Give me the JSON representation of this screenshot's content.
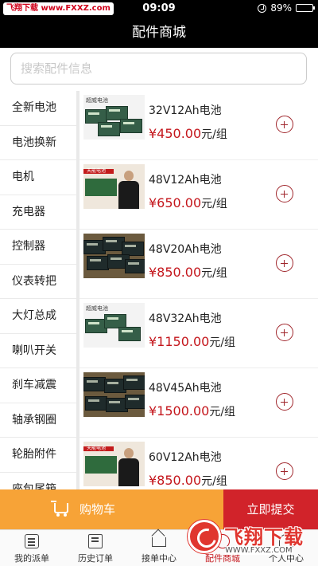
{
  "status_bar": {
    "watermark": "飞翔下载 www.FXXZ.com",
    "time": "09:09",
    "battery": "89%",
    "battery_level": 0.89
  },
  "nav": {
    "title": "配件商城"
  },
  "search": {
    "placeholder": "搜索配件信息",
    "value": ""
  },
  "sidebar": {
    "items": [
      {
        "label": "全新电池",
        "active": true
      },
      {
        "label": "电池换新"
      },
      {
        "label": "电机"
      },
      {
        "label": "充电器"
      },
      {
        "label": "控制器"
      },
      {
        "label": "仪表转把"
      },
      {
        "label": "大灯总成"
      },
      {
        "label": "喇叭开关"
      },
      {
        "label": "刹车减震"
      },
      {
        "label": "轴承钢圈"
      },
      {
        "label": "轮胎附件"
      },
      {
        "label": "座包尾箱"
      }
    ]
  },
  "products": [
    {
      "name": "32V12Ah电池",
      "price": "¥450.00",
      "unit": "元/组",
      "thumb_label": "超威电池"
    },
    {
      "name": "48V12Ah电池",
      "price": "¥650.00",
      "unit": "元/组",
      "thumb_label": "天能电池"
    },
    {
      "name": "48V20Ah电池",
      "price": "¥850.00",
      "unit": "元/组"
    },
    {
      "name": "48V32Ah电池",
      "price": "¥1150.00",
      "unit": "元/组",
      "thumb_label": "超威电池"
    },
    {
      "name": "48V45Ah电池",
      "price": "¥1500.00",
      "unit": "元/组"
    },
    {
      "name": "60V12Ah电池",
      "price": "¥850.00",
      "unit": "元/组",
      "thumb_label": "天能电池"
    }
  ],
  "action_bar": {
    "cart_label": "购物车",
    "submit_label": "立即提交"
  },
  "tab_bar": {
    "tabs": [
      {
        "label": "我的派单",
        "icon": "dispatch-icon"
      },
      {
        "label": "历史订单",
        "icon": "history-icon"
      },
      {
        "label": "接单中心",
        "icon": "receive-icon"
      },
      {
        "label": "配件商城",
        "icon": "shop-icon",
        "active": true
      },
      {
        "label": "个人中心",
        "icon": "user-icon"
      }
    ]
  },
  "watermark": {
    "brand": "飞翔下载",
    "url": "WWW.FXXZ.COM"
  },
  "colors": {
    "accent_red": "#c4161c",
    "cart_orange": "#f7a337",
    "submit_red": "#d1232a"
  }
}
